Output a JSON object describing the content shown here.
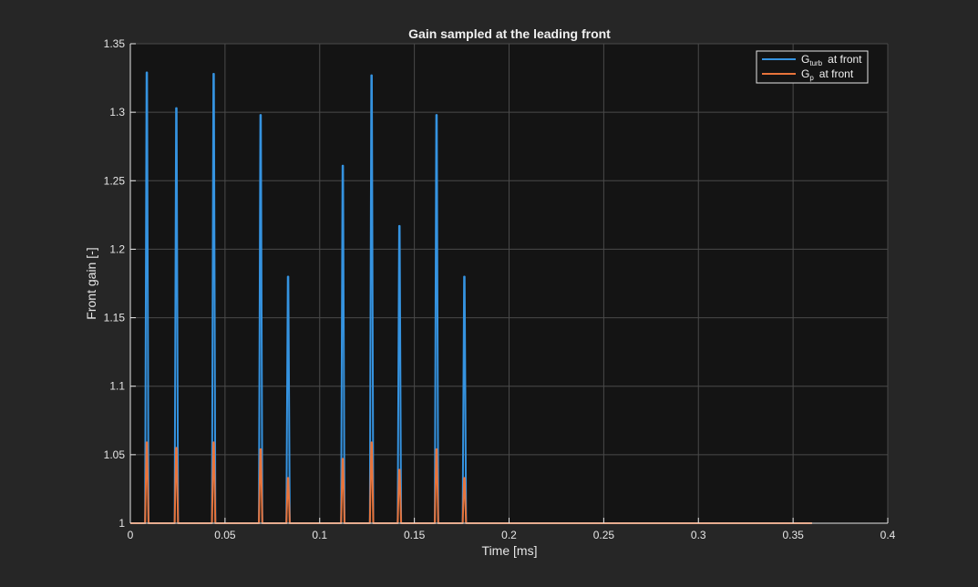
{
  "chart_data": {
    "type": "line",
    "title": "Gain sampled at the leading front",
    "xlabel": "Time [ms]",
    "ylabel": "Front gain [-]",
    "xlim": [
      0,
      0.4
    ],
    "ylim": [
      1,
      1.35
    ],
    "xticks": [
      0,
      0.05,
      0.1,
      0.15,
      0.2,
      0.25,
      0.3,
      0.35,
      0.4
    ],
    "xtick_labels": [
      "0",
      "0.05",
      "0.1",
      "0.15",
      "0.2",
      "0.25",
      "0.3",
      "0.35",
      "0.4"
    ],
    "yticks": [
      1,
      1.05,
      1.1,
      1.15,
      1.2,
      1.25,
      1.3,
      1.35
    ],
    "ytick_labels": [
      "1",
      "1.05",
      "1.1",
      "1.15",
      "1.2",
      "1.25",
      "1.3",
      "1.35"
    ],
    "grid": true,
    "legend_position": "top-right",
    "background": "#141414",
    "figure_background": "#262626",
    "series": [
      {
        "name": "G_turb at front",
        "legend_main": "G",
        "legend_sub": "turb",
        "legend_rest": "at front",
        "color": "#3593e0",
        "peaks": [
          {
            "t": 0.0087,
            "g": 1.329
          },
          {
            "t": 0.0243,
            "g": 1.303
          },
          {
            "t": 0.044,
            "g": 1.328
          },
          {
            "t": 0.0688,
            "g": 1.298
          },
          {
            "t": 0.0833,
            "g": 1.18
          },
          {
            "t": 0.1122,
            "g": 1.261
          },
          {
            "t": 0.1274,
            "g": 1.327
          },
          {
            "t": 0.1421,
            "g": 1.217
          },
          {
            "t": 0.1617,
            "g": 1.298
          },
          {
            "t": 0.1764,
            "g": 1.18
          }
        ]
      },
      {
        "name": "G_p at front",
        "legend_main": "G",
        "legend_sub": "p",
        "legend_rest": "at front",
        "color": "#e8743b",
        "peaks": [
          {
            "t": 0.0087,
            "g": 1.059
          },
          {
            "t": 0.0243,
            "g": 1.055
          },
          {
            "t": 0.044,
            "g": 1.059
          },
          {
            "t": 0.0688,
            "g": 1.054
          },
          {
            "t": 0.0833,
            "g": 1.033
          },
          {
            "t": 0.1122,
            "g": 1.047
          },
          {
            "t": 0.1274,
            "g": 1.059
          },
          {
            "t": 0.1421,
            "g": 1.039
          },
          {
            "t": 0.1617,
            "g": 1.054
          },
          {
            "t": 0.1764,
            "g": 1.033
          }
        ]
      }
    ]
  }
}
